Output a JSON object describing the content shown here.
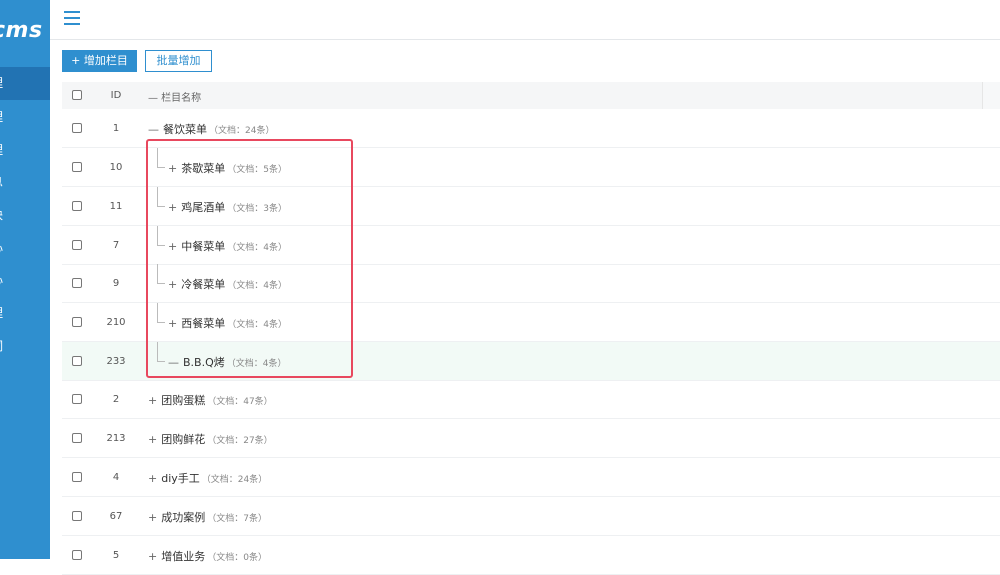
{
  "app": {
    "logo_text": "cms"
  },
  "sidebar": {
    "items": [
      {
        "label": "理",
        "active": true
      },
      {
        "label": "理",
        "active": false
      },
      {
        "label": "理",
        "active": false
      },
      {
        "label": "息",
        "active": false
      },
      {
        "label": "块",
        "active": false
      },
      {
        "label": "心",
        "active": false
      },
      {
        "label": "心",
        "active": false
      },
      {
        "label": "理",
        "active": false
      },
      {
        "label": "词",
        "active": false
      }
    ]
  },
  "toolbar": {
    "add_label": "+ 增加栏目",
    "batch_add_label": "批量增加"
  },
  "table": {
    "headers": {
      "id": "ID",
      "name": "— 栏目名称"
    },
    "rows": [
      {
        "id": "1",
        "sign": "—",
        "name": "餐饮菜单",
        "doc": "（文档：24条）",
        "level": 0,
        "highlight": false
      },
      {
        "id": "10",
        "sign": "+",
        "name": "茶歇菜单",
        "doc": "（文档：5条）",
        "level": 1,
        "highlight": false
      },
      {
        "id": "11",
        "sign": "+",
        "name": "鸡尾酒单",
        "doc": "（文档：3条）",
        "level": 1,
        "highlight": false
      },
      {
        "id": "7",
        "sign": "+",
        "name": "中餐菜单",
        "doc": "（文档：4条）",
        "level": 1,
        "highlight": false
      },
      {
        "id": "9",
        "sign": "+",
        "name": "冷餐菜单",
        "doc": "（文档：4条）",
        "level": 1,
        "highlight": false
      },
      {
        "id": "210",
        "sign": "+",
        "name": "西餐菜单",
        "doc": "（文档：4条）",
        "level": 1,
        "highlight": false
      },
      {
        "id": "233",
        "sign": "—",
        "name": "B.B.Q烤",
        "doc": "（文档：4条）",
        "level": 1,
        "highlight": true
      },
      {
        "id": "2",
        "sign": "+",
        "name": "团购蛋糕",
        "doc": "（文档：47条）",
        "level": 0,
        "highlight": false
      },
      {
        "id": "213",
        "sign": "+",
        "name": "团购鲜花",
        "doc": "（文档：27条）",
        "level": 0,
        "highlight": false
      },
      {
        "id": "4",
        "sign": "+",
        "name": "diy手工",
        "doc": "（文档：24条）",
        "level": 0,
        "highlight": false
      },
      {
        "id": "67",
        "sign": "+",
        "name": "成功案例",
        "doc": "（文档：7条）",
        "level": 0,
        "highlight": false
      },
      {
        "id": "5",
        "sign": "+",
        "name": "增值业务",
        "doc": "（文档：0条）",
        "level": 0,
        "highlight": false
      }
    ]
  },
  "colors": {
    "sidebar_bg": "#2f8fcf",
    "sidebar_active": "#2273b3",
    "primary": "#2f8fcf",
    "annotation": "#e8485e",
    "highlight_row": "#f2faf6"
  }
}
